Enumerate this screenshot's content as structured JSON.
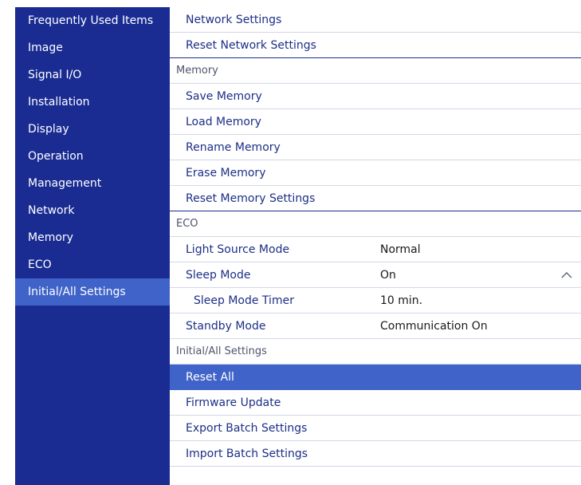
{
  "sidebar": {
    "items": [
      {
        "label": "Frequently Used Items"
      },
      {
        "label": "Image"
      },
      {
        "label": "Signal I/O"
      },
      {
        "label": "Installation"
      },
      {
        "label": "Display"
      },
      {
        "label": "Operation"
      },
      {
        "label": "Management"
      },
      {
        "label": "Network"
      },
      {
        "label": "Memory"
      },
      {
        "label": "ECO"
      },
      {
        "label": "Initial/All Settings",
        "selected": true
      }
    ]
  },
  "panel": {
    "network": {
      "network_settings": "Network Settings",
      "reset_network_settings": "Reset Network Settings"
    },
    "memory": {
      "header": "Memory",
      "save": "Save Memory",
      "load": "Load Memory",
      "rename": "Rename Memory",
      "erase": "Erase Memory",
      "reset": "Reset Memory Settings"
    },
    "eco": {
      "header": "ECO",
      "light_source_mode": {
        "label": "Light Source Mode",
        "value": "Normal"
      },
      "sleep_mode": {
        "label": "Sleep Mode",
        "value": "On"
      },
      "sleep_mode_timer": {
        "label": "Sleep Mode Timer",
        "value": "10 min."
      },
      "standby_mode": {
        "label": "Standby Mode",
        "value": "Communication On"
      }
    },
    "initial": {
      "header": "Initial/All Settings",
      "reset_all": "Reset All",
      "firmware_update": "Firmware Update",
      "export_batch": "Export Batch Settings",
      "import_batch": "Import Batch Settings"
    }
  },
  "colors": {
    "sidebar_bg": "#1a2c92",
    "selection": "#3f63c9",
    "item_text": "#1c2f86"
  },
  "icons": {
    "sleep_mode_expand": "chevron-up-icon"
  }
}
